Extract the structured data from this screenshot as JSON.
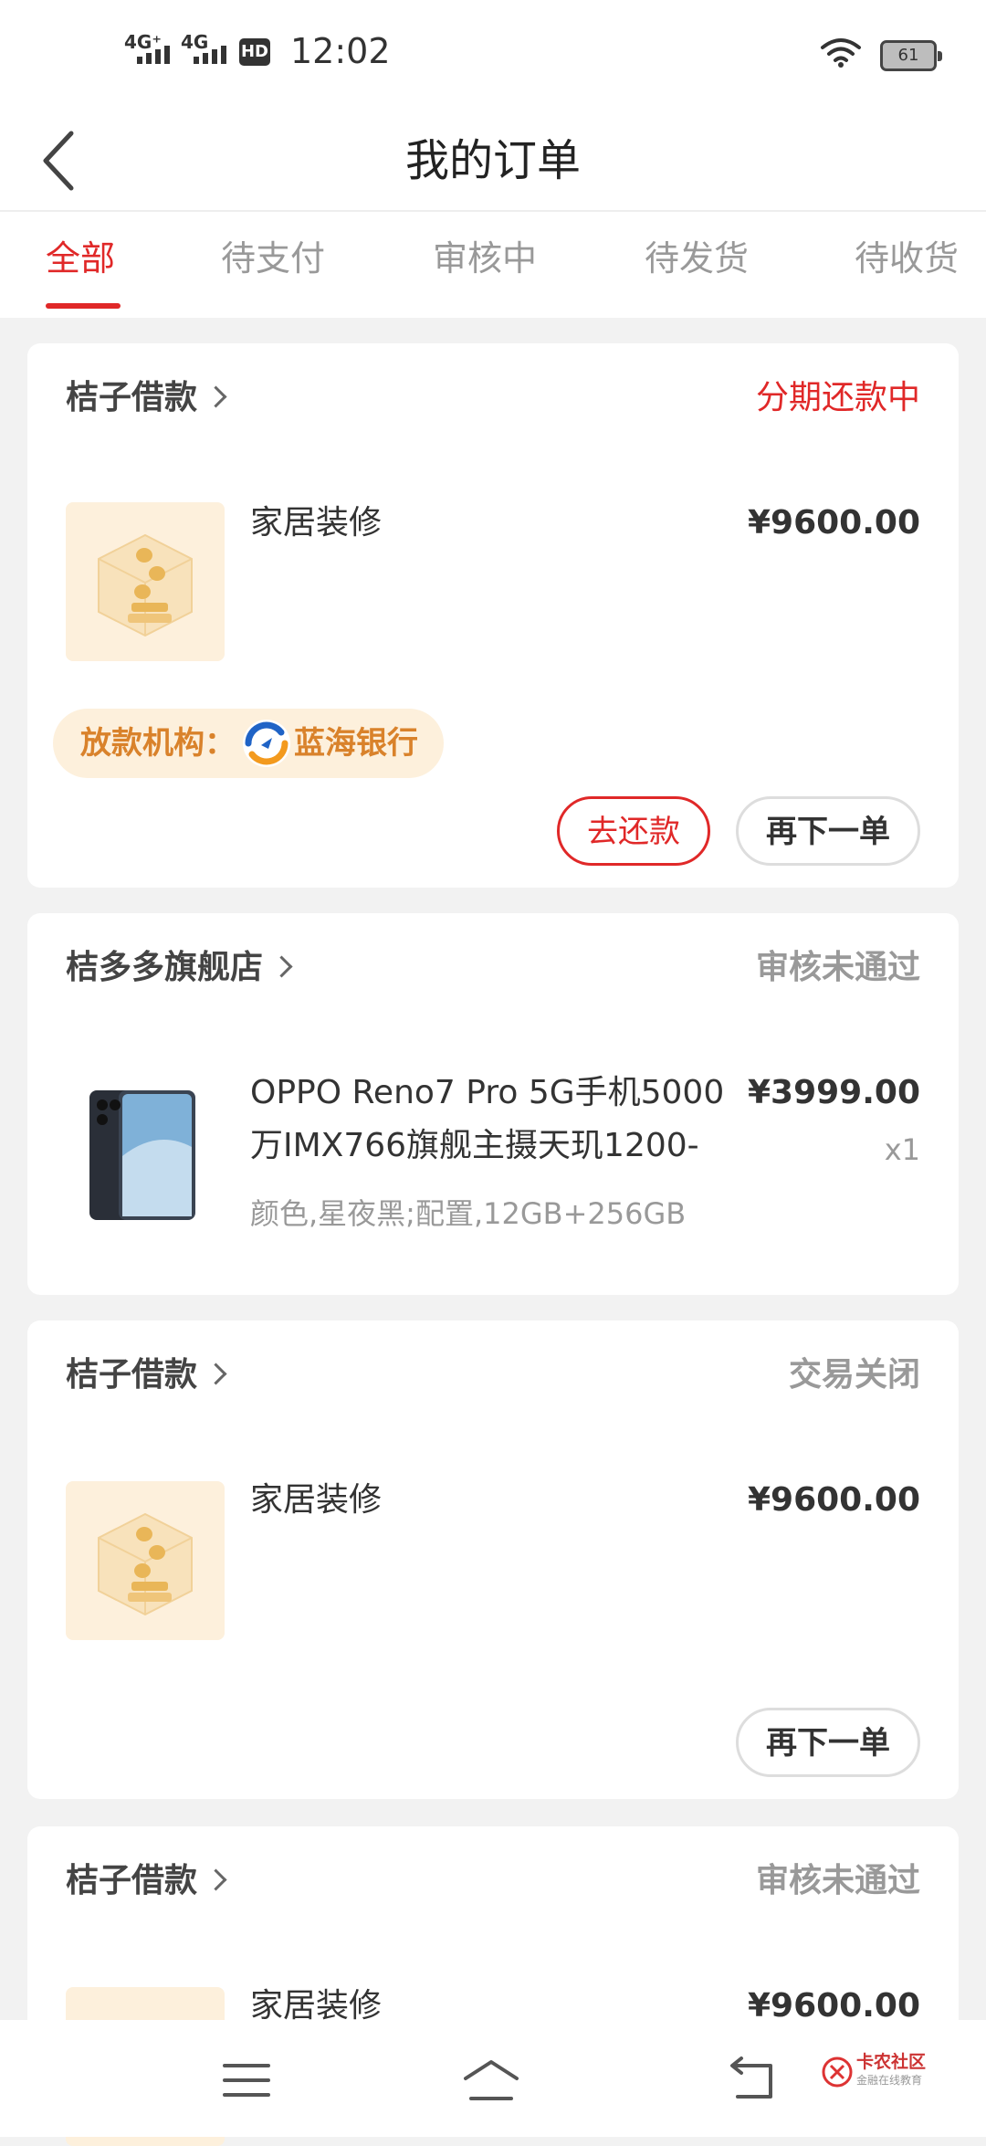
{
  "status_bar": {
    "signal1": "4G⁺",
    "signal2": "4G",
    "hd": "HD",
    "time": "12:02",
    "battery": "61"
  },
  "header": {
    "title": "我的订单",
    "back_icon": "chevron-left-icon"
  },
  "tabs": [
    {
      "label": "全部",
      "active": true
    },
    {
      "label": "待支付"
    },
    {
      "label": "审核中"
    },
    {
      "label": "待发货"
    },
    {
      "label": "待收货"
    }
  ],
  "orders": [
    {
      "shop": "桔子借款",
      "status": "分期还款中",
      "item_name": "家居装修",
      "price": "¥9600.00",
      "lender_label": "放款机构：",
      "lender_name": "蓝海银行",
      "buttons": [
        "去还款",
        "再下一单"
      ]
    },
    {
      "shop": "桔多多旗舰店",
      "status": "审核未通过",
      "item_name_line1": "OPPO Reno7 Pro 5G手机5000",
      "item_name_line2": "万IMX766旗舰主摄天玑1200-",
      "spec": "颜色,星夜黑;配置,12GB+256GB",
      "price": "¥3999.00",
      "qty": "x1"
    },
    {
      "shop": "桔子借款",
      "status": "交易关闭",
      "item_name": "家居装修",
      "price": "¥9600.00",
      "buttons": [
        "再下一单"
      ]
    },
    {
      "shop": "桔子借款",
      "status": "审核未通过",
      "item_name": "家居装修",
      "price": "¥9600.00"
    }
  ],
  "watermark": {
    "title": "卡农社区",
    "subtitle": "金融在线教育"
  },
  "colors": {
    "accent": "#e02828",
    "lender": "#d9822b",
    "thumb_bg": "#fdf0dc"
  }
}
